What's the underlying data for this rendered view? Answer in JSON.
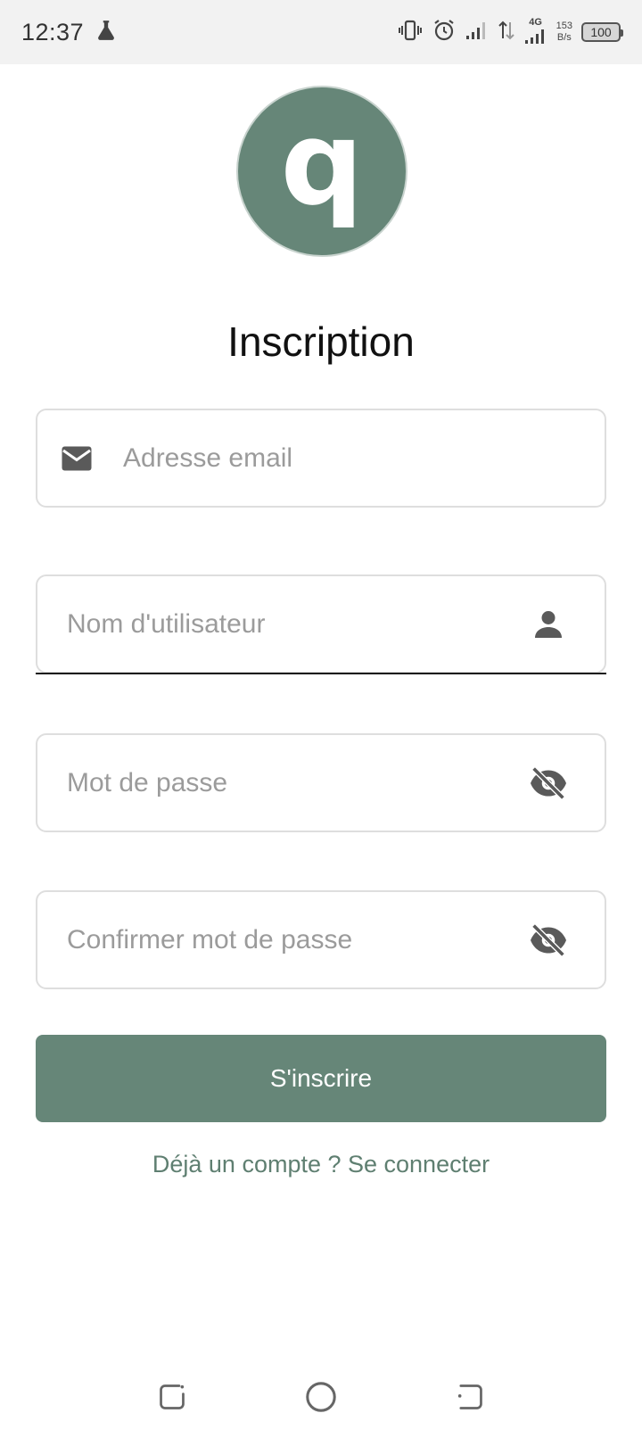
{
  "status_bar": {
    "time": "12:37",
    "network_type": "4G",
    "net_speed_value": "153",
    "net_speed_unit": "B/s",
    "battery_level": "100"
  },
  "logo": {
    "letter": "q",
    "color": "#668678"
  },
  "page": {
    "title": "Inscription"
  },
  "form": {
    "email_placeholder": "Adresse email",
    "username_placeholder": "Nom d'utilisateur",
    "password_placeholder": "Mot de passe",
    "confirm_password_placeholder": "Confirmer mot de passe",
    "submit_label": "S'inscrire",
    "login_link": "Déjà un compte ? Se connecter"
  },
  "icons": {
    "email": "mail-icon",
    "username": "person-icon",
    "password": "eye-off-icon",
    "confirm_password": "eye-off-icon"
  },
  "colors": {
    "accent": "#668678",
    "link": "#5f7f71",
    "field_border": "#dedede",
    "placeholder": "#9b9b9b"
  }
}
